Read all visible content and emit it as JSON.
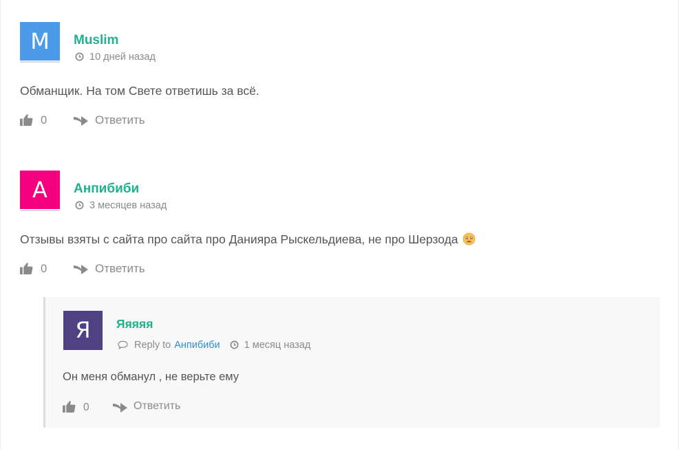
{
  "comments": [
    {
      "avatar_letter": "M",
      "avatar_color": "#4c9be8",
      "author": "Muslim",
      "time": "10 дней назад",
      "text": "Обманщик. На том Свете ответишь за всё.",
      "likes": "0",
      "reply_label": "Ответить"
    },
    {
      "avatar_letter": "А",
      "avatar_color": "#f4007f",
      "author": "Анпибиби",
      "time": "3 месяцев назад",
      "text": "Отзывы взяты с сайта про сайта про Данияра Рыскельдиева, не про Шерзода",
      "emoji": "frowning-face-emoji",
      "likes": "0",
      "reply_label": "Ответить"
    }
  ],
  "reply": {
    "avatar_letter": "Я",
    "avatar_color": "#4e4283",
    "author": "Яяяяя",
    "reply_to_label": "Reply to",
    "reply_to_name": "Анпибиби",
    "time": "1 месяц назад",
    "text": "Он меня обманул , не верьте ему",
    "likes": "0",
    "reply_label": "Ответить"
  },
  "icons": {
    "clock": "clock-icon",
    "like": "thumbs-up-icon",
    "reply": "share-arrow-icon",
    "bubble": "comment-bubble-icon"
  }
}
